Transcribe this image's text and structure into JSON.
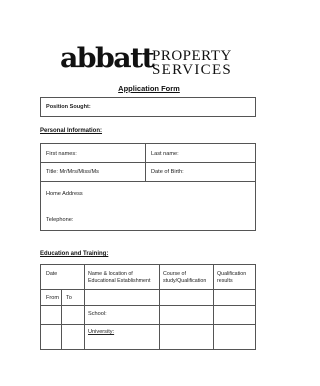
{
  "logo": {
    "wordmark": "abbatt",
    "line1": "PROPERTY",
    "line2": "SERVICES"
  },
  "form_title": "Application Form",
  "position": {
    "label": "Position Sought:"
  },
  "personal": {
    "heading": "Personal Information:",
    "first_names": "First names:",
    "last_name": "Last name:",
    "title": "Title: Mr/Mrs/Miss/Ms",
    "dob": "Date of Birth:",
    "home_address": "Home Address",
    "telephone": "Telephone:"
  },
  "education": {
    "heading": "Education and Training:",
    "col_date": "Date",
    "col_name_line1": "Name & location of",
    "col_name_line2": "Educational Establishment",
    "col_course_line1": "Course of",
    "col_course_line2": "study/Qualification",
    "col_qual_line1": "Qualification",
    "col_qual_line2": "results",
    "from": "From",
    "to": "To",
    "school": "School:",
    "university": "University:"
  }
}
